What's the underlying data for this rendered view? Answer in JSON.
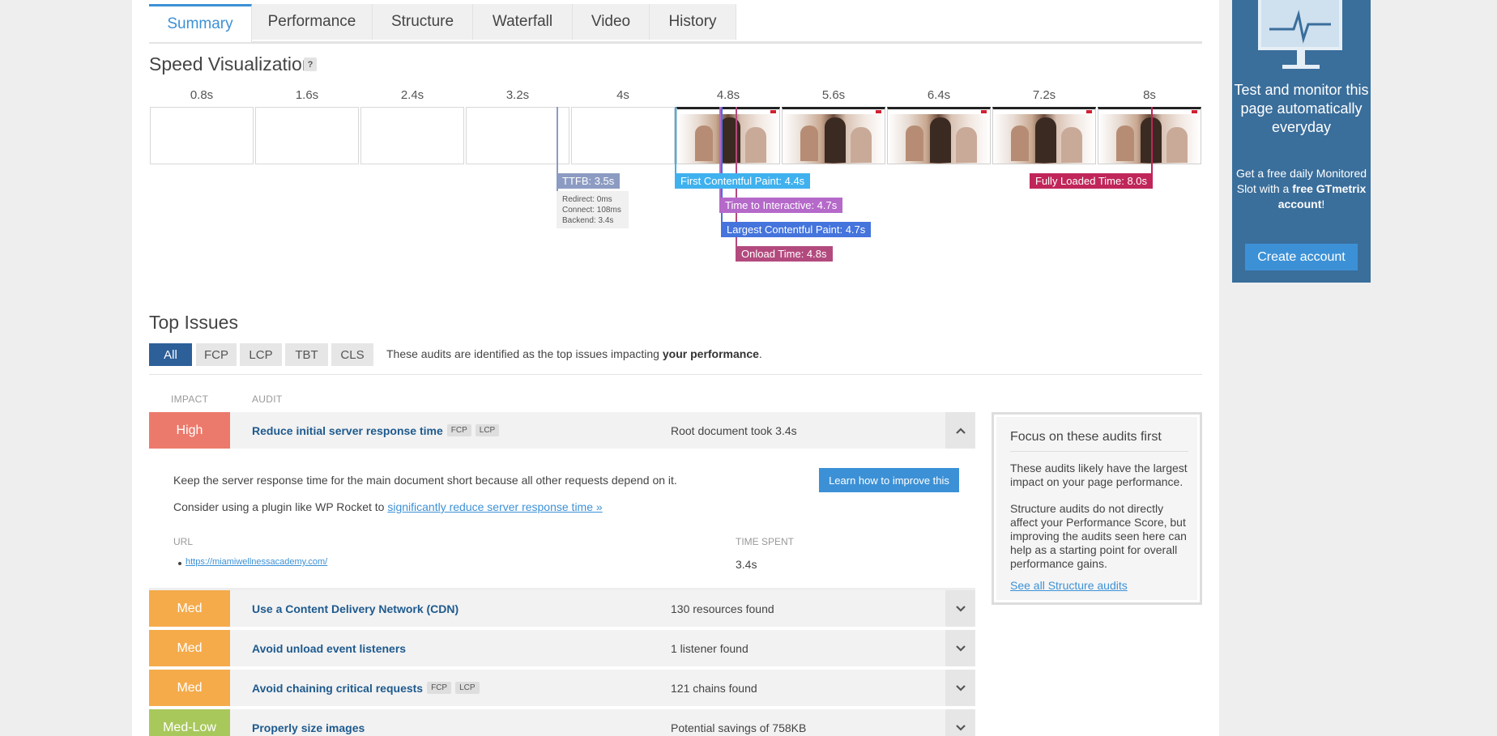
{
  "tabs": [
    "Summary",
    "Performance",
    "Structure",
    "Waterfall",
    "Video",
    "History"
  ],
  "speed": {
    "title": "Speed Visualization",
    "help": "?",
    "times": [
      "0.8s",
      "1.6s",
      "2.4s",
      "3.2s",
      "4s",
      "4.8s",
      "5.6s",
      "6.4s",
      "7.2s",
      "8s"
    ],
    "markers": {
      "ttfb": "TTFB: 3.5s",
      "ttfb_redirect": "Redirect: 0ms",
      "ttfb_connect": "Connect: 108ms",
      "ttfb_backend": "Backend: 3.4s",
      "fcp": "First Contentful Paint: 4.4s",
      "tti": "Time to Interactive: 4.7s",
      "lcp": "Largest Contentful Paint: 4.7s",
      "onload": "Onload Time: 4.8s",
      "fully": "Fully Loaded Time: 8.0s"
    },
    "colors": {
      "ttfb": "#8c9bc2",
      "fcp": "#3fb1ee",
      "tti": "#b569c9",
      "lcp": "#4474dc",
      "onload": "#b34a7e",
      "fully": "#c0265a"
    }
  },
  "issues": {
    "title": "Top Issues",
    "filters": [
      "All",
      "FCP",
      "LCP",
      "TBT",
      "CLS"
    ],
    "note_prefix": "These audits are identified as the top issues impacting ",
    "note_bold": "your performance",
    "note_suffix": ".",
    "col_impact": "IMPACT",
    "col_audit": "AUDIT",
    "rows": [
      {
        "impact": "High",
        "audit": "Reduce initial server response time",
        "tags": [
          "FCP",
          "LCP"
        ],
        "desc": "Root document took 3.4s"
      },
      {
        "impact": "Med",
        "audit": "Use a Content Delivery Network (CDN)",
        "tags": [],
        "desc": "130 resources found"
      },
      {
        "impact": "Med",
        "audit": "Avoid unload event listeners",
        "tags": [],
        "desc": "1 listener found"
      },
      {
        "impact": "Med",
        "audit": "Avoid chaining critical requests",
        "tags": [
          "FCP",
          "LCP"
        ],
        "desc": "121 chains found"
      },
      {
        "impact": "Med-Low",
        "audit": "Properly size images",
        "tags": [],
        "desc": "Potential savings of 758KB"
      }
    ],
    "impact_colors": {
      "High": "#ec7a6c",
      "Med": "#f5ab4a",
      "Med-Low": "#a8c85c"
    },
    "detail": {
      "text1": "Keep the server response time for the main document short because all other requests depend on it.",
      "text2_prefix": "Consider using a plugin like WP Rocket to ",
      "text2_link": "significantly reduce server response time »",
      "learn": "Learn how to improve this",
      "url_header": "URL",
      "time_header": "TIME SPENT",
      "url": "https://miamiwellnessacademy.com/",
      "time": "3.4s"
    }
  },
  "focus": {
    "title": "Focus on these audits first",
    "p1": "These audits likely have the largest impact on your page performance.",
    "p2": "Structure audits do not directly affect your Performance Score, but improving the audits seen here can help as a starting point for overall performance gains.",
    "link": "See all Structure audits"
  },
  "ad": {
    "headline": "Test and monitor this page automatically everyday",
    "text_prefix": "Get a free daily Monitored Slot with a ",
    "text_bold": "free GTmetrix account",
    "text_suffix": "!",
    "button": "Create account"
  }
}
